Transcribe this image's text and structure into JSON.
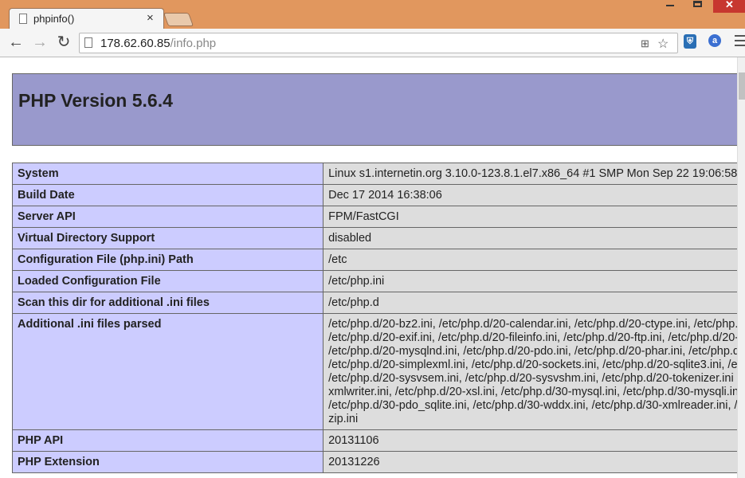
{
  "browser": {
    "tab_title": "phpinfo()",
    "tab_close": "×",
    "url_host": "178.62.60.85",
    "url_path": "/info.php"
  },
  "page": {
    "header": "PHP Version 5.6.4",
    "rows": [
      {
        "key": "System",
        "value": "Linux s1.internetin.org 3.10.0-123.8.1.el7.x86_64 #1 SMP Mon Sep 22 19:06:58"
      },
      {
        "key": "Build Date",
        "value": "Dec 17 2014 16:38:06"
      },
      {
        "key": "Server API",
        "value": "FPM/FastCGI"
      },
      {
        "key": "Virtual Directory Support",
        "value": "disabled"
      },
      {
        "key": "Configuration File (php.ini) Path",
        "value": "/etc"
      },
      {
        "key": "Loaded Configuration File",
        "value": "/etc/php.ini"
      },
      {
        "key": "Scan this dir for additional .ini files",
        "value": "/etc/php.d"
      },
      {
        "key": "Additional .ini files parsed",
        "value": "/etc/php.d/20-bz2.ini, /etc/php.d/20-calendar.ini, /etc/php.d/20-ctype.ini, /etc/php.\n/etc/php.d/20-exif.ini, /etc/php.d/20-fileinfo.ini, /etc/php.d/20-ftp.ini, /etc/php.d/20-g\n/etc/php.d/20-mysqlnd.ini, /etc/php.d/20-pdo.ini, /etc/php.d/20-phar.ini, /etc/php.d\n/etc/php.d/20-simplexml.ini, /etc/php.d/20-sockets.ini, /etc/php.d/20-sqlite3.ini, /e\n/etc/php.d/20-sysvsem.ini, /etc/php.d/20-sysvshm.ini, /etc/php.d/20-tokenizer.ini\nxmlwriter.ini, /etc/php.d/20-xsl.ini, /etc/php.d/30-mysql.ini, /etc/php.d/30-mysqli.in\n/etc/php.d/30-pdo_sqlite.ini, /etc/php.d/30-wddx.ini, /etc/php.d/30-xmlreader.ini, /\nzip.ini"
      },
      {
        "key": "PHP API",
        "value": "20131106"
      },
      {
        "key": "PHP Extension",
        "value": "20131226"
      }
    ]
  }
}
